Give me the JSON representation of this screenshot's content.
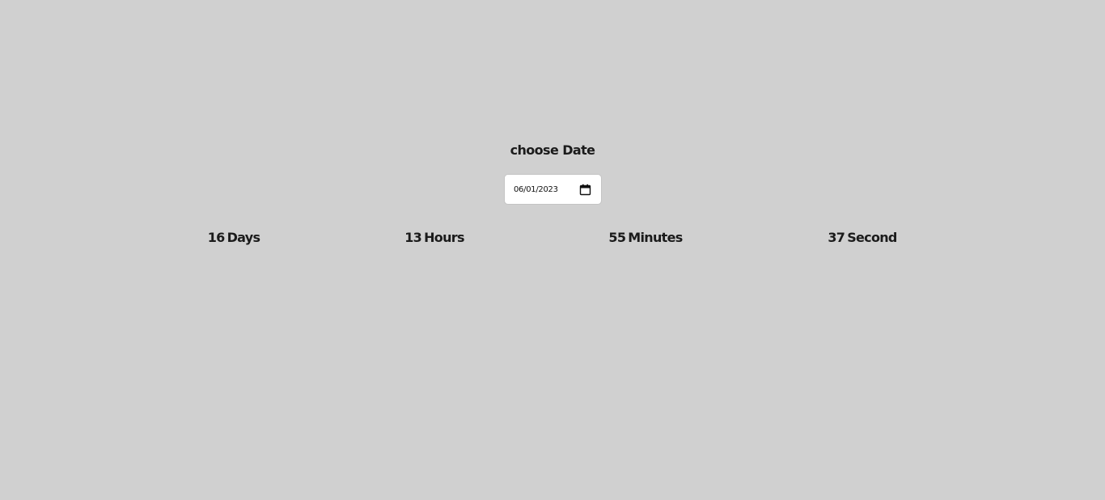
{
  "heading": "choose Date",
  "date_input": {
    "value": "06/01/2023",
    "icon": "calendar-icon"
  },
  "countdown": {
    "days": {
      "value": "16",
      "unit": "Days"
    },
    "hours": {
      "value": "13",
      "unit": "Hours"
    },
    "minutes": {
      "value": "55",
      "unit": "Minutes"
    },
    "seconds": {
      "value": "37",
      "unit": "Second"
    }
  },
  "colors": {
    "background": "#d0d0d0",
    "text": "#1b1b1b",
    "input_background": "#ffffff"
  }
}
